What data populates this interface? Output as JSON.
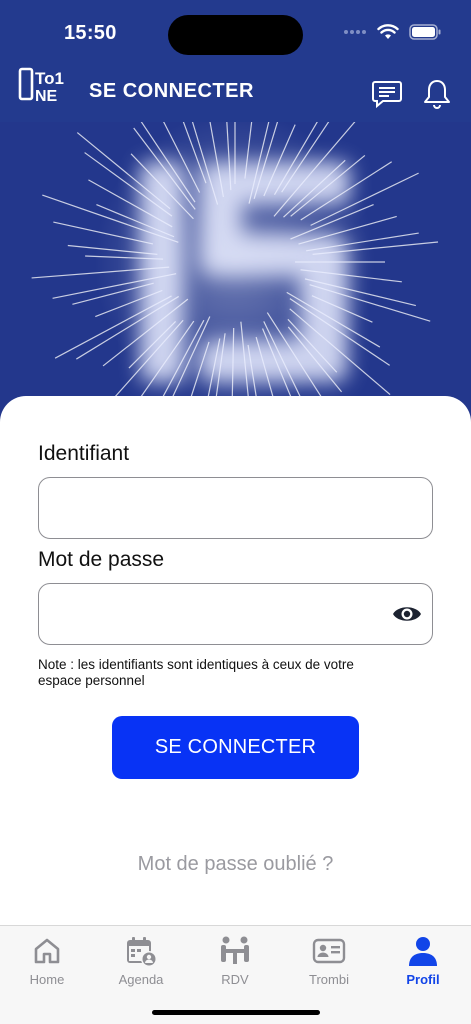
{
  "status": {
    "time": "15:50"
  },
  "header": {
    "logo_text": "To1NE",
    "title": "SE CONNECTER"
  },
  "form": {
    "identifier_label": "Identifiant",
    "identifier_value": "",
    "password_label": "Mot de passe",
    "password_value": "",
    "note": "Note : les identifiants sont identiques à ceux de votre espace personnel",
    "submit_label": "SE CONNECTER",
    "forgot_label": "Mot de passe oublié ?"
  },
  "tabs": [
    {
      "label": "Home",
      "icon": "home-icon",
      "active": false
    },
    {
      "label": "Agenda",
      "icon": "calendar-user-icon",
      "active": false
    },
    {
      "label": "RDV",
      "icon": "meeting-icon",
      "active": false
    },
    {
      "label": "Trombi",
      "icon": "id-card-icon",
      "active": false
    },
    {
      "label": "Profil",
      "icon": "user-icon",
      "active": true
    }
  ],
  "colors": {
    "header_bg": "#233a8e",
    "primary_button": "#0833f5",
    "active_tab": "#1245e8"
  }
}
